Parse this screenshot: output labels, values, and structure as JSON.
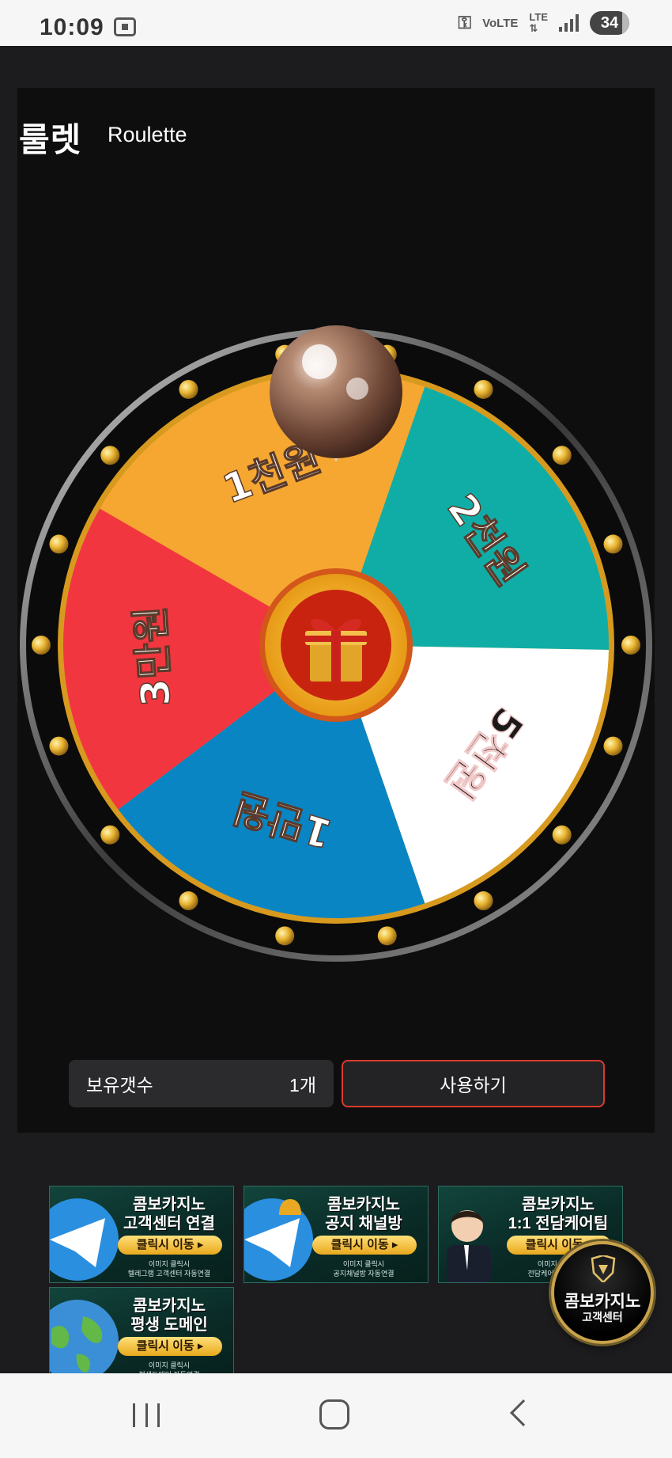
{
  "status_bar": {
    "time": "10:09",
    "icons": [
      "screenshot-icon",
      "key-icon",
      "volte-icon",
      "lte-icon",
      "signal-icon"
    ],
    "volte": "VoLTE",
    "lte": "LTE",
    "battery": "34"
  },
  "header": {
    "title": "룰렛",
    "subtitle": "Roulette"
  },
  "wheel": {
    "segments": [
      {
        "label": "1천원",
        "color": "#f6a731"
      },
      {
        "label": "2천원",
        "color": "#10ada7"
      },
      {
        "label": "5천원",
        "color": "#ffffff"
      },
      {
        "label": "1만원",
        "color": "#0a85c3"
      },
      {
        "label": "3만원",
        "color": "#f2363f"
      }
    ],
    "center_icon": "gift-box-icon",
    "pointer_icon": "pointer-knob-icon"
  },
  "controls": {
    "hold_label": "보유갯수",
    "hold_value": "1개",
    "use_button": "사용하기"
  },
  "banners": [
    {
      "line1": "콤보카지노",
      "line2": "고객센터 연결",
      "button": "클릭시 이동 ▸",
      "note1": "이미지 클릭시",
      "note2": "텔레그램 고객센터 자동연결",
      "icon": "telegram-icon"
    },
    {
      "line1": "콤보카지노",
      "line2": "공지 채널방",
      "button": "클릭시 이동 ▸",
      "note1": "이미지 클릭시",
      "note2": "공지채널방 자동연결",
      "icon": "telegram-bell-icon"
    },
    {
      "line1": "콤보카지노",
      "line2": "1:1 전담케어팀",
      "button": "클릭시 이동 ▸",
      "note1": "이미지 클릭시",
      "note2": "전담케어팀 자동연결",
      "icon": "agent-avatar-icon"
    },
    {
      "line1": "콤보카지노",
      "line2": "평생 도메인",
      "button": "클릭시 이동 ▸",
      "note1": "이미지 클릭시",
      "note2": "평생도메인 자동연결",
      "icon": "globe-icon"
    }
  ],
  "floating_button": {
    "line1": "콤보카지노",
    "line2": "고객센터",
    "icon": "crest-icon"
  },
  "nav_bar": {
    "icons": [
      "recent-apps-icon",
      "home-icon",
      "back-icon"
    ]
  }
}
